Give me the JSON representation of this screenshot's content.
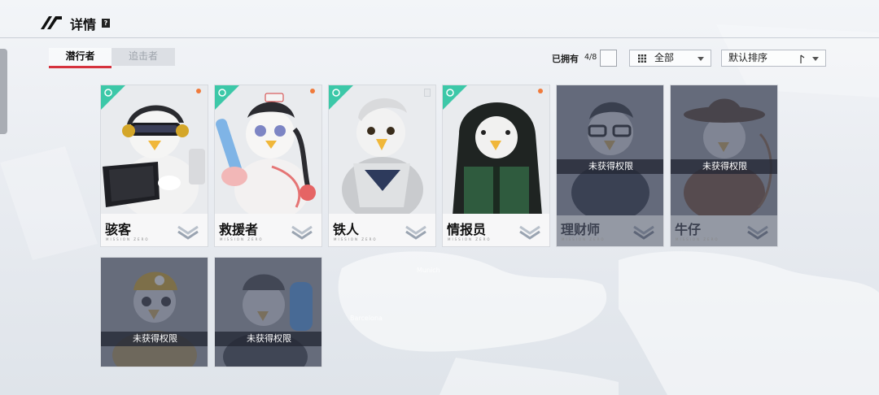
{
  "header": {
    "title": "详情",
    "help_icon": "?"
  },
  "tabs": [
    {
      "label": "潜行者",
      "active": true
    },
    {
      "label": "追击者",
      "active": false
    }
  ],
  "filters": {
    "owned_label": "已拥有",
    "owned_count": "4/8",
    "category_selected": "全部",
    "sort_selected": "默认排序"
  },
  "map_labels": [
    "Munich",
    "Barcelona"
  ],
  "cards": [
    {
      "name": "骇客",
      "sub": "MISSION ZERO",
      "owned": true,
      "locked_text": ""
    },
    {
      "name": "救援者",
      "sub": "MISSION ZERO",
      "owned": true,
      "locked_text": ""
    },
    {
      "name": "铁人",
      "sub": "MISSION ZERO",
      "owned": true,
      "locked_text": ""
    },
    {
      "name": "情报员",
      "sub": "MISSION ZERO",
      "owned": true,
      "locked_text": ""
    },
    {
      "name": "理财师",
      "sub": "MISSION ZERO",
      "owned": false,
      "locked_text": "未获得权限"
    },
    {
      "name": "牛仔",
      "sub": "MISSION ZERO",
      "owned": false,
      "locked_text": "未获得权限"
    },
    {
      "name": "",
      "sub": "",
      "owned": false,
      "locked_text": "未获得权限"
    },
    {
      "name": "",
      "sub": "",
      "owned": false,
      "locked_text": "未获得权限"
    }
  ],
  "colors": {
    "accent_red": "#d6323e",
    "badge_teal": "#3cc8a8",
    "dot_orange": "#f07a3b"
  }
}
